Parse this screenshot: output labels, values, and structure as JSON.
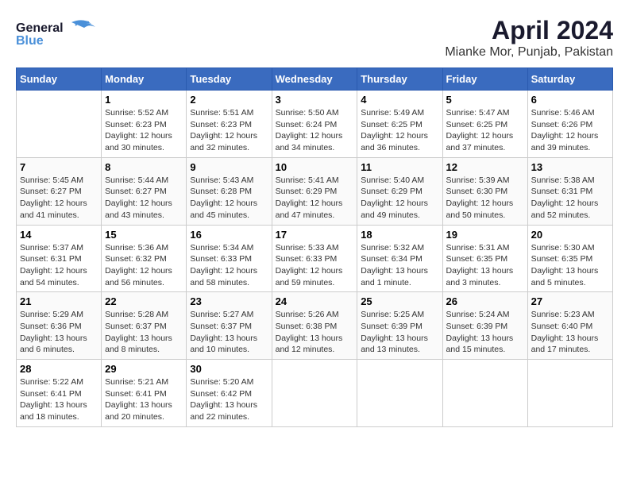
{
  "header": {
    "logo_general": "General",
    "logo_blue": "Blue",
    "title": "April 2024",
    "subtitle": "Mianke Mor, Punjab, Pakistan"
  },
  "days_of_week": [
    "Sunday",
    "Monday",
    "Tuesday",
    "Wednesday",
    "Thursday",
    "Friday",
    "Saturday"
  ],
  "weeks": [
    [
      {
        "day": "",
        "sunrise": "",
        "sunset": "",
        "daylight": ""
      },
      {
        "day": "1",
        "sunrise": "Sunrise: 5:52 AM",
        "sunset": "Sunset: 6:23 PM",
        "daylight": "Daylight: 12 hours and 30 minutes."
      },
      {
        "day": "2",
        "sunrise": "Sunrise: 5:51 AM",
        "sunset": "Sunset: 6:23 PM",
        "daylight": "Daylight: 12 hours and 32 minutes."
      },
      {
        "day": "3",
        "sunrise": "Sunrise: 5:50 AM",
        "sunset": "Sunset: 6:24 PM",
        "daylight": "Daylight: 12 hours and 34 minutes."
      },
      {
        "day": "4",
        "sunrise": "Sunrise: 5:49 AM",
        "sunset": "Sunset: 6:25 PM",
        "daylight": "Daylight: 12 hours and 36 minutes."
      },
      {
        "day": "5",
        "sunrise": "Sunrise: 5:47 AM",
        "sunset": "Sunset: 6:25 PM",
        "daylight": "Daylight: 12 hours and 37 minutes."
      },
      {
        "day": "6",
        "sunrise": "Sunrise: 5:46 AM",
        "sunset": "Sunset: 6:26 PM",
        "daylight": "Daylight: 12 hours and 39 minutes."
      }
    ],
    [
      {
        "day": "7",
        "sunrise": "Sunrise: 5:45 AM",
        "sunset": "Sunset: 6:27 PM",
        "daylight": "Daylight: 12 hours and 41 minutes."
      },
      {
        "day": "8",
        "sunrise": "Sunrise: 5:44 AM",
        "sunset": "Sunset: 6:27 PM",
        "daylight": "Daylight: 12 hours and 43 minutes."
      },
      {
        "day": "9",
        "sunrise": "Sunrise: 5:43 AM",
        "sunset": "Sunset: 6:28 PM",
        "daylight": "Daylight: 12 hours and 45 minutes."
      },
      {
        "day": "10",
        "sunrise": "Sunrise: 5:41 AM",
        "sunset": "Sunset: 6:29 PM",
        "daylight": "Daylight: 12 hours and 47 minutes."
      },
      {
        "day": "11",
        "sunrise": "Sunrise: 5:40 AM",
        "sunset": "Sunset: 6:29 PM",
        "daylight": "Daylight: 12 hours and 49 minutes."
      },
      {
        "day": "12",
        "sunrise": "Sunrise: 5:39 AM",
        "sunset": "Sunset: 6:30 PM",
        "daylight": "Daylight: 12 hours and 50 minutes."
      },
      {
        "day": "13",
        "sunrise": "Sunrise: 5:38 AM",
        "sunset": "Sunset: 6:31 PM",
        "daylight": "Daylight: 12 hours and 52 minutes."
      }
    ],
    [
      {
        "day": "14",
        "sunrise": "Sunrise: 5:37 AM",
        "sunset": "Sunset: 6:31 PM",
        "daylight": "Daylight: 12 hours and 54 minutes."
      },
      {
        "day": "15",
        "sunrise": "Sunrise: 5:36 AM",
        "sunset": "Sunset: 6:32 PM",
        "daylight": "Daylight: 12 hours and 56 minutes."
      },
      {
        "day": "16",
        "sunrise": "Sunrise: 5:34 AM",
        "sunset": "Sunset: 6:33 PM",
        "daylight": "Daylight: 12 hours and 58 minutes."
      },
      {
        "day": "17",
        "sunrise": "Sunrise: 5:33 AM",
        "sunset": "Sunset: 6:33 PM",
        "daylight": "Daylight: 12 hours and 59 minutes."
      },
      {
        "day": "18",
        "sunrise": "Sunrise: 5:32 AM",
        "sunset": "Sunset: 6:34 PM",
        "daylight": "Daylight: 13 hours and 1 minute."
      },
      {
        "day": "19",
        "sunrise": "Sunrise: 5:31 AM",
        "sunset": "Sunset: 6:35 PM",
        "daylight": "Daylight: 13 hours and 3 minutes."
      },
      {
        "day": "20",
        "sunrise": "Sunrise: 5:30 AM",
        "sunset": "Sunset: 6:35 PM",
        "daylight": "Daylight: 13 hours and 5 minutes."
      }
    ],
    [
      {
        "day": "21",
        "sunrise": "Sunrise: 5:29 AM",
        "sunset": "Sunset: 6:36 PM",
        "daylight": "Daylight: 13 hours and 6 minutes."
      },
      {
        "day": "22",
        "sunrise": "Sunrise: 5:28 AM",
        "sunset": "Sunset: 6:37 PM",
        "daylight": "Daylight: 13 hours and 8 minutes."
      },
      {
        "day": "23",
        "sunrise": "Sunrise: 5:27 AM",
        "sunset": "Sunset: 6:37 PM",
        "daylight": "Daylight: 13 hours and 10 minutes."
      },
      {
        "day": "24",
        "sunrise": "Sunrise: 5:26 AM",
        "sunset": "Sunset: 6:38 PM",
        "daylight": "Daylight: 13 hours and 12 minutes."
      },
      {
        "day": "25",
        "sunrise": "Sunrise: 5:25 AM",
        "sunset": "Sunset: 6:39 PM",
        "daylight": "Daylight: 13 hours and 13 minutes."
      },
      {
        "day": "26",
        "sunrise": "Sunrise: 5:24 AM",
        "sunset": "Sunset: 6:39 PM",
        "daylight": "Daylight: 13 hours and 15 minutes."
      },
      {
        "day": "27",
        "sunrise": "Sunrise: 5:23 AM",
        "sunset": "Sunset: 6:40 PM",
        "daylight": "Daylight: 13 hours and 17 minutes."
      }
    ],
    [
      {
        "day": "28",
        "sunrise": "Sunrise: 5:22 AM",
        "sunset": "Sunset: 6:41 PM",
        "daylight": "Daylight: 13 hours and 18 minutes."
      },
      {
        "day": "29",
        "sunrise": "Sunrise: 5:21 AM",
        "sunset": "Sunset: 6:41 PM",
        "daylight": "Daylight: 13 hours and 20 minutes."
      },
      {
        "day": "30",
        "sunrise": "Sunrise: 5:20 AM",
        "sunset": "Sunset: 6:42 PM",
        "daylight": "Daylight: 13 hours and 22 minutes."
      },
      {
        "day": "",
        "sunrise": "",
        "sunset": "",
        "daylight": ""
      },
      {
        "day": "",
        "sunrise": "",
        "sunset": "",
        "daylight": ""
      },
      {
        "day": "",
        "sunrise": "",
        "sunset": "",
        "daylight": ""
      },
      {
        "day": "",
        "sunrise": "",
        "sunset": "",
        "daylight": ""
      }
    ]
  ]
}
